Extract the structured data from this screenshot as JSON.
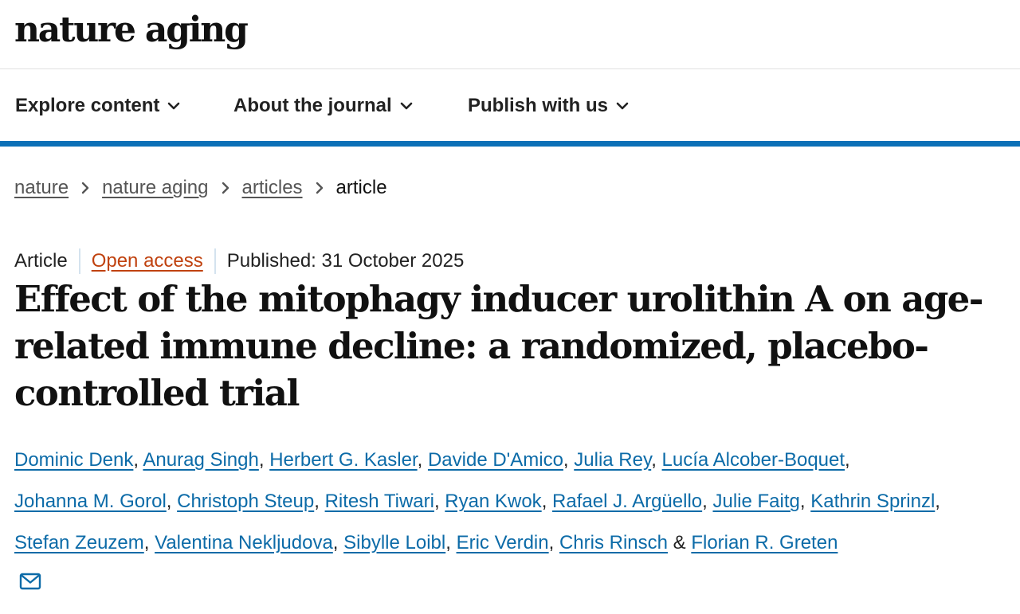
{
  "header": {
    "logo": "nature aging"
  },
  "nav": {
    "items": [
      {
        "label": "Explore content"
      },
      {
        "label": "About the journal"
      },
      {
        "label": "Publish with us"
      }
    ]
  },
  "breadcrumb": {
    "items": [
      "nature",
      "nature aging",
      "articles"
    ],
    "current": "article"
  },
  "article": {
    "type": "Article",
    "open_access": "Open access",
    "published": "Published: 31 October 2025",
    "title": "Effect of the mitophagy inducer urolithin A on age-related immune decline: a randomized, placebo-controlled trial",
    "authors": [
      "Dominic Denk",
      "Anurag Singh",
      "Herbert G. Kasler",
      "Davide D'Amico",
      "Julia Rey",
      "Lucía Alcober-Boquet",
      "Johanna M. Gorol",
      "Christoph Steup",
      "Ritesh Tiwari",
      "Ryan Kwok",
      "Rafael J. Argüello",
      "Julie Faitg",
      "Kathrin Sprinzl",
      "Stefan Zeuzem",
      "Valentina Nekljudova",
      "Sibylle Loibl",
      "Eric Verdin",
      "Chris Rinsch",
      "Florian R. Greten"
    ],
    "author_separator": ", ",
    "last_author_separator": " & ",
    "contact_icon": "mail-icon"
  },
  "colors": {
    "accent": "#0c70b7",
    "link": "#0c6ba8",
    "open_access": "#c0420f"
  }
}
